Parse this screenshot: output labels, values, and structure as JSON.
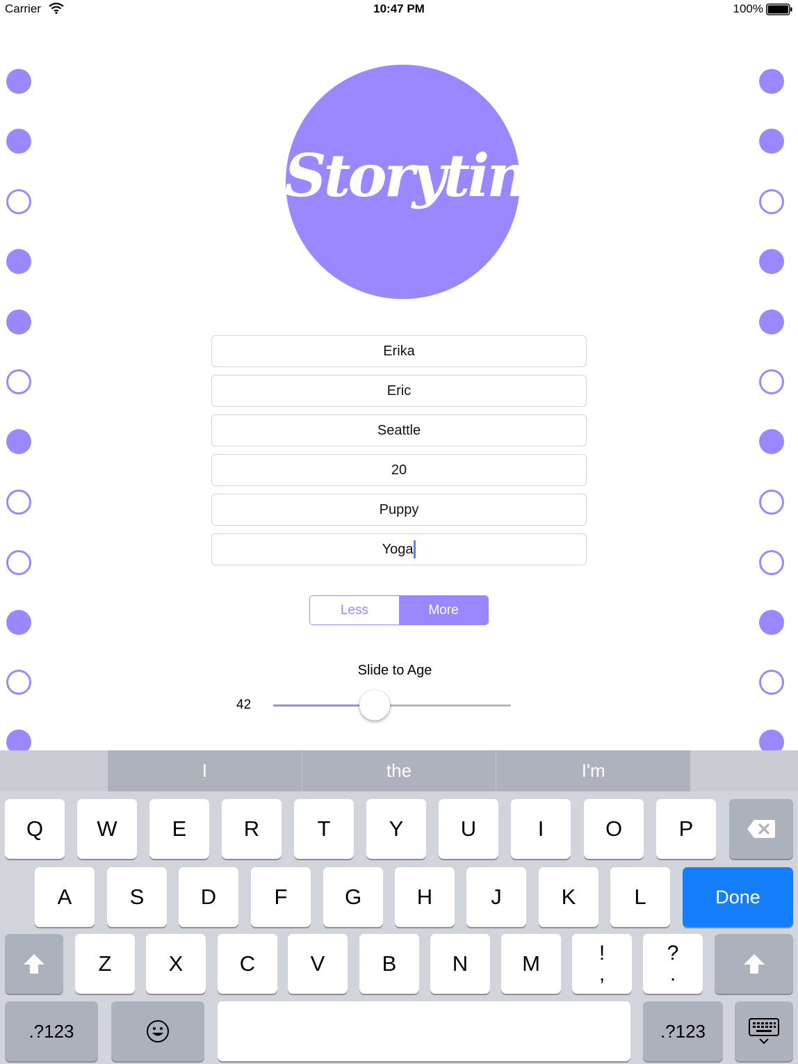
{
  "status_bar": {
    "carrier": "Carrier",
    "time": "10:47 PM",
    "battery": "100%"
  },
  "logo": {
    "text": "Storytime"
  },
  "fields": [
    {
      "value": "Erika"
    },
    {
      "value": "Eric"
    },
    {
      "value": "Seattle"
    },
    {
      "value": "20"
    },
    {
      "value": "Puppy"
    },
    {
      "value": "Yoga"
    }
  ],
  "segmented": {
    "options": [
      "Less",
      "More"
    ],
    "selected": "More"
  },
  "slider": {
    "title": "Slide to Age",
    "value": "42"
  },
  "keyboard": {
    "suggestions": [
      "I",
      "the",
      "I'm"
    ],
    "row1": [
      "Q",
      "W",
      "E",
      "R",
      "T",
      "Y",
      "U",
      "I",
      "O",
      "P"
    ],
    "row2": [
      "A",
      "S",
      "D",
      "F",
      "G",
      "H",
      "J",
      "K",
      "L"
    ],
    "row3": [
      "Z",
      "X",
      "C",
      "V",
      "B",
      "N",
      "M"
    ],
    "punct1": {
      "top": "!",
      "bottom": ","
    },
    "punct2": {
      "top": "?",
      "bottom": "."
    },
    "done_label": "Done",
    "numbers_label": ".?123",
    "icons": {
      "backspace": "backspace-icon",
      "shift": "shift-icon",
      "emoji": "emoji-icon",
      "dismiss": "keyboard-dismiss-icon"
    }
  },
  "colors": {
    "accent": "#9b87ff",
    "done": "#157efb"
  }
}
